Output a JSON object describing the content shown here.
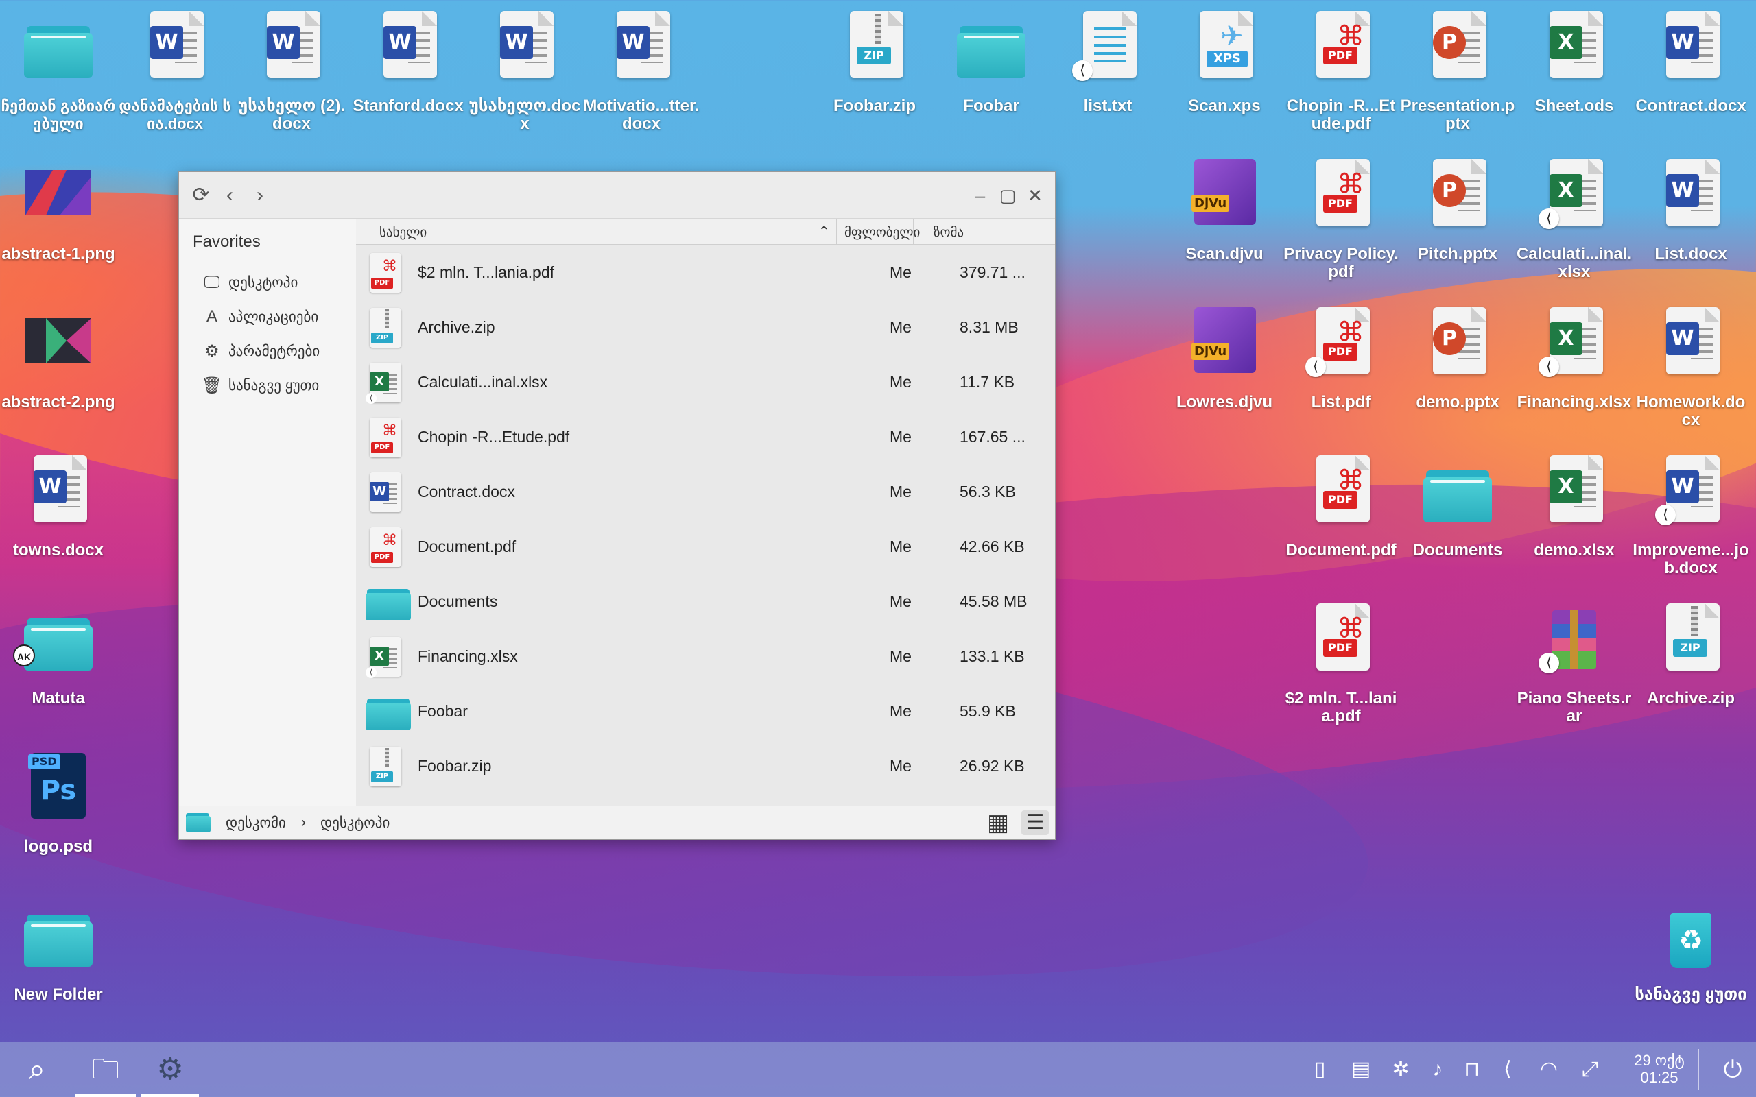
{
  "desktop": {
    "icons": [
      {
        "label": "ჩემთან გაზიარებული"
      },
      {
        "label": "დანამატების სია.docx"
      },
      {
        "label": "უსახელო (2).docx"
      },
      {
        "label": "Stanford.docx"
      },
      {
        "label": "უსახელო.docx"
      },
      {
        "label": "Motivatio...tter.docx"
      },
      {
        "label": "Foobar.zip"
      },
      {
        "label": "Foobar"
      },
      {
        "label": "list.txt"
      },
      {
        "label": "Scan.xps"
      },
      {
        "label": "Chopin -R...Etude.pdf"
      },
      {
        "label": "Presentation.pptx"
      },
      {
        "label": "Sheet.ods"
      },
      {
        "label": "Contract.docx"
      },
      {
        "label": "abstract-1.png"
      },
      {
        "label": "Scan.djvu"
      },
      {
        "label": "Privacy Policy.pdf"
      },
      {
        "label": "Pitch.pptx"
      },
      {
        "label": "Calculati...inal.xlsx"
      },
      {
        "label": "List.docx"
      },
      {
        "label": "abstract-2.png"
      },
      {
        "label": "Lowres.djvu"
      },
      {
        "label": "List.pdf"
      },
      {
        "label": "demo.pptx"
      },
      {
        "label": "Financing.xlsx"
      },
      {
        "label": "Homework.docx"
      },
      {
        "label": "towns.docx"
      },
      {
        "label": "Document.pdf"
      },
      {
        "label": "Documents"
      },
      {
        "label": "demo.xlsx"
      },
      {
        "label": "Improveme...job.docx"
      },
      {
        "label": "Matuta"
      },
      {
        "label": "$2 mln. T...lania.pdf"
      },
      {
        "label": "Piano Sheets.rar"
      },
      {
        "label": "Archive.zip"
      },
      {
        "label": "logo.psd"
      },
      {
        "label": "New Folder"
      },
      {
        "label": "სანაგვე ყუთი"
      }
    ],
    "avatar_initials": "AK"
  },
  "window": {
    "sidebar": {
      "heading": "Favorites",
      "items": [
        {
          "label": "დესკტოპი",
          "icon": "monitor-icon"
        },
        {
          "label": "აპლიკაციები",
          "icon": "apps-icon"
        },
        {
          "label": "პარამეტრები",
          "icon": "gear-icon"
        },
        {
          "label": "სანაგვე ყუთი",
          "icon": "trash-icon"
        }
      ]
    },
    "columns": {
      "name": "სახელი",
      "owner": "მფლობელი",
      "size": "ზომა"
    },
    "files": [
      {
        "name": "$2 mln. T...lania.pdf",
        "owner": "Me",
        "size": "379.71 ..."
      },
      {
        "name": "Archive.zip",
        "owner": "Me",
        "size": "8.31 MB"
      },
      {
        "name": "Calculati...inal.xlsx",
        "owner": "Me",
        "size": "11.7 KB"
      },
      {
        "name": "Chopin -R...Etude.pdf",
        "owner": "Me",
        "size": "167.65 ..."
      },
      {
        "name": "Contract.docx",
        "owner": "Me",
        "size": "56.3 KB"
      },
      {
        "name": "Document.pdf",
        "owner": "Me",
        "size": "42.66 KB"
      },
      {
        "name": "Documents",
        "owner": "Me",
        "size": "45.58 MB"
      },
      {
        "name": "Financing.xlsx",
        "owner": "Me",
        "size": "133.1 KB"
      },
      {
        "name": "Foobar",
        "owner": "Me",
        "size": "55.9 KB"
      },
      {
        "name": "Foobar.zip",
        "owner": "Me",
        "size": "26.92 KB"
      }
    ],
    "breadcrumb": {
      "root": "დესკომი",
      "separator": "›",
      "current": "დესკტოპი"
    }
  },
  "taskbar": {
    "clock_date": "29 ოქტ",
    "clock_time": "01:25"
  },
  "colors": {
    "folder": "#2aaebe",
    "word": "#2b4fa8",
    "excel": "#1f7a44",
    "powerpoint": "#d0482a",
    "pdf": "#dd2222"
  }
}
